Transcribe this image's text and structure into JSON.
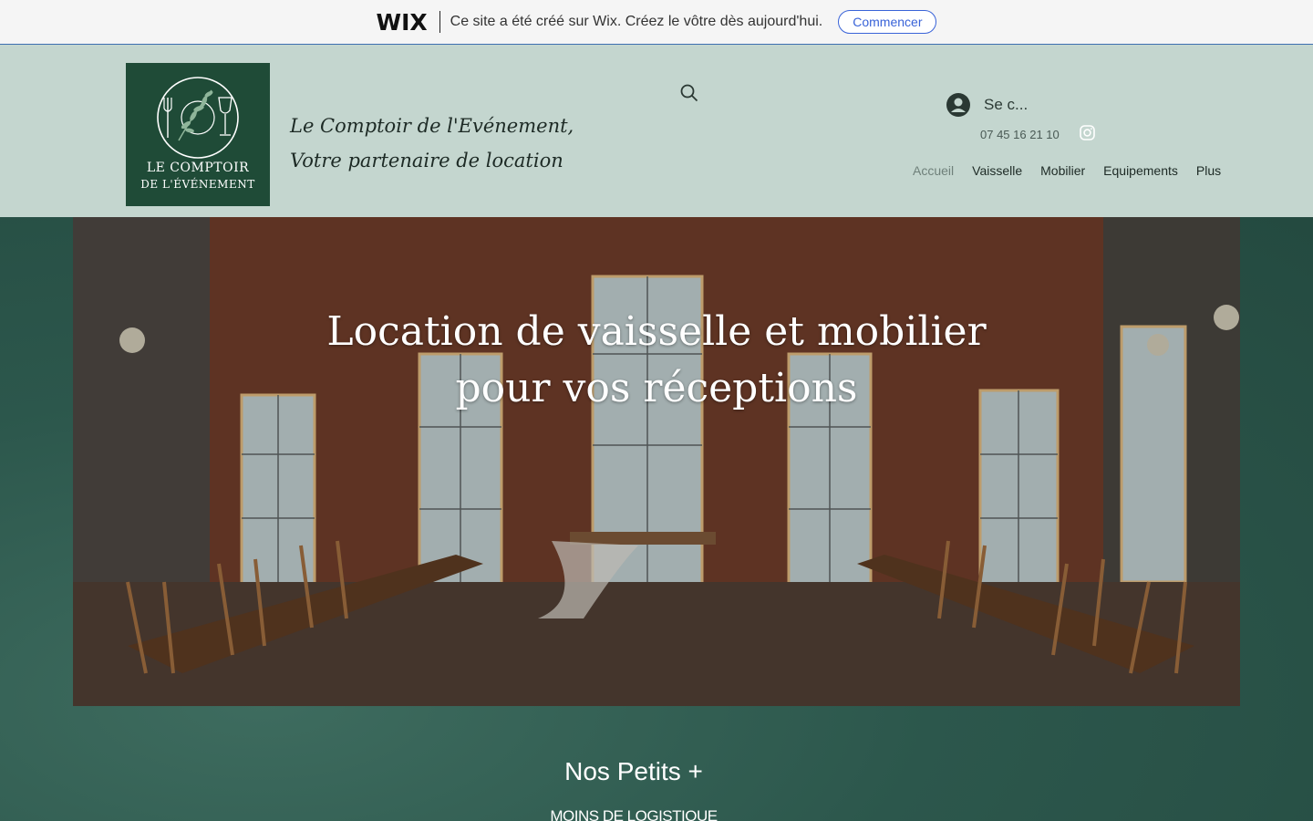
{
  "wix_banner": {
    "logo": "WIX",
    "message": "Ce site a été créé sur Wix. Créez le vôtre dès aujourd'hui.",
    "cta_label": "Commencer"
  },
  "header": {
    "logo": {
      "line1": "LE COMPTOIR",
      "line2": "DE L'ÉVÉNEMENT"
    },
    "tagline": {
      "line1": "Le Comptoir de l'Evénement,",
      "line2": "Votre partenaire de location"
    },
    "login_label": "Se c...",
    "phone": "07 45 16 21 10",
    "nav": [
      {
        "label": "Accueil",
        "active": true
      },
      {
        "label": "Vaisselle",
        "active": false
      },
      {
        "label": "Mobilier",
        "active": false
      },
      {
        "label": "Equipements",
        "active": false
      },
      {
        "label": "Plus",
        "active": false
      }
    ],
    "icons": {
      "search": "search-icon",
      "login": "user-avatar-icon",
      "social": "instagram-icon"
    }
  },
  "hero": {
    "title_line1": "Location de vaisselle et mobilier",
    "title_line2": "pour vos réceptions"
  },
  "section": {
    "title": "Nos Petits +",
    "subtitle": "MOINS DE LOGISTIQUE"
  },
  "colors": {
    "header_bg": "#c4d6cf",
    "logo_bg": "#1f4b37",
    "page_bg": "#2f5a50",
    "wix_cta": "#3963d8"
  }
}
